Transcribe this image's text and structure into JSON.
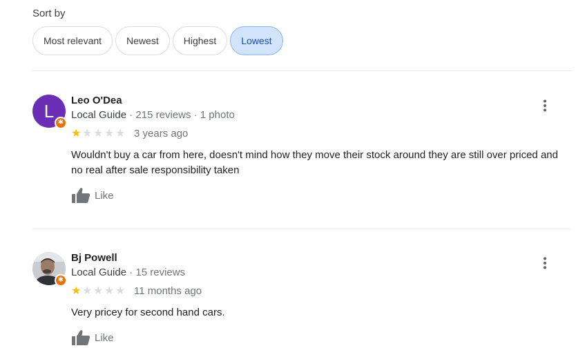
{
  "sort": {
    "label": "Sort by",
    "options": [
      {
        "label": "Most relevant",
        "selected": false
      },
      {
        "label": "Newest",
        "selected": false
      },
      {
        "label": "Highest",
        "selected": false
      },
      {
        "label": "Lowest",
        "selected": true
      }
    ]
  },
  "reviews": [
    {
      "avatar_letter": "L",
      "avatar_color": "#6a2fb5",
      "name": "Leo O'Dea",
      "guide_label": "Local Guide",
      "reviews_count": "215 reviews",
      "photos_count": "1 photo",
      "rating": 1,
      "rating_max": 5,
      "date": "3 years ago",
      "text": "Wouldn't buy a car from here, doesn't mind how they move their stock around they are still over priced and no real after sale responsibility taken",
      "like_label": "Like"
    },
    {
      "avatar_letter": "",
      "name": "Bj Powell",
      "guide_label": "Local Guide",
      "reviews_count": "15 reviews",
      "rating": 1,
      "rating_max": 5,
      "date": "11 months ago",
      "text": "Very pricey for second hand cars.",
      "like_label": "Like"
    }
  ],
  "colors": {
    "selected_chip_bg": "#d2e3fc",
    "star_filled": "#fbbc04",
    "star_empty": "#dadce0",
    "local_guide_badge": "#e8710a"
  },
  "icons": [
    "local-guide-badge-icon",
    "star-icon",
    "thumbs-up-icon",
    "more-vert-icon",
    "user-avatar-photo"
  ]
}
